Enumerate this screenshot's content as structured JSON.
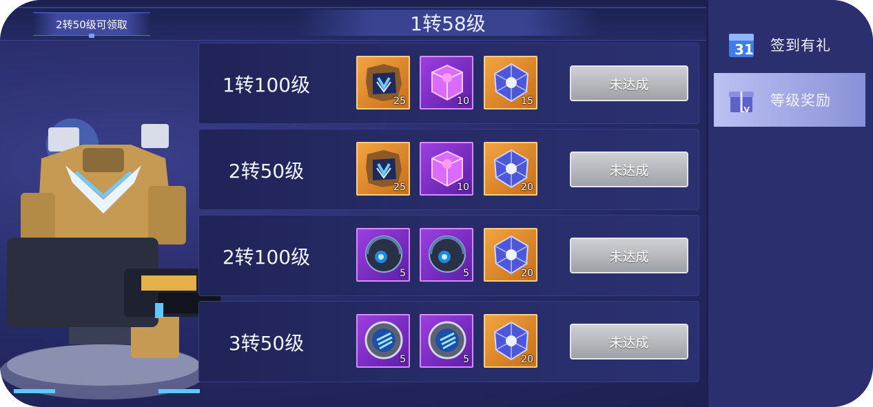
{
  "header": {
    "claim_tab": "2转50级可领取",
    "current_level": "1转58级"
  },
  "rewards": [
    {
      "level": "1转100级",
      "status": "未达成",
      "items": [
        {
          "icon": "blueprint-puzzle-icon",
          "quantity": "25",
          "rarity": "orange"
        },
        {
          "icon": "pink-cube-icon",
          "quantity": "10",
          "rarity": "purple"
        },
        {
          "icon": "crystal-icon",
          "quantity": "15",
          "rarity": "orange"
        }
      ]
    },
    {
      "level": "2转50级",
      "status": "未达成",
      "items": [
        {
          "icon": "blueprint-puzzle-icon",
          "quantity": "25",
          "rarity": "orange"
        },
        {
          "icon": "pink-cube-icon",
          "quantity": "10",
          "rarity": "purple"
        },
        {
          "icon": "crystal-icon",
          "quantity": "20",
          "rarity": "orange"
        }
      ]
    },
    {
      "level": "2转100级",
      "status": "未达成",
      "items": [
        {
          "icon": "tech-sphere-icon",
          "quantity": "5",
          "rarity": "purple"
        },
        {
          "icon": "tech-sphere-icon",
          "quantity": "5",
          "rarity": "purple"
        },
        {
          "icon": "crystal-icon",
          "quantity": "20",
          "rarity": "orange"
        }
      ]
    },
    {
      "level": "3转50级",
      "status": "未达成",
      "items": [
        {
          "icon": "energy-core-icon",
          "quantity": "5",
          "rarity": "purple"
        },
        {
          "icon": "energy-core-icon",
          "quantity": "5",
          "rarity": "purple"
        },
        {
          "icon": "crystal-icon",
          "quantity": "20",
          "rarity": "orange"
        }
      ]
    }
  ],
  "side_menu": [
    {
      "label": "签到有礼",
      "icon": "calendar-gift-icon",
      "active": false
    },
    {
      "label": "等级奖励",
      "icon": "level-gift-icon",
      "active": true
    }
  ],
  "colors": {
    "accent": "#5a6bd6",
    "orange_rarity": "#f3a341",
    "purple_rarity": "#9c3fe0",
    "button_gray": "#b5b7bd"
  }
}
